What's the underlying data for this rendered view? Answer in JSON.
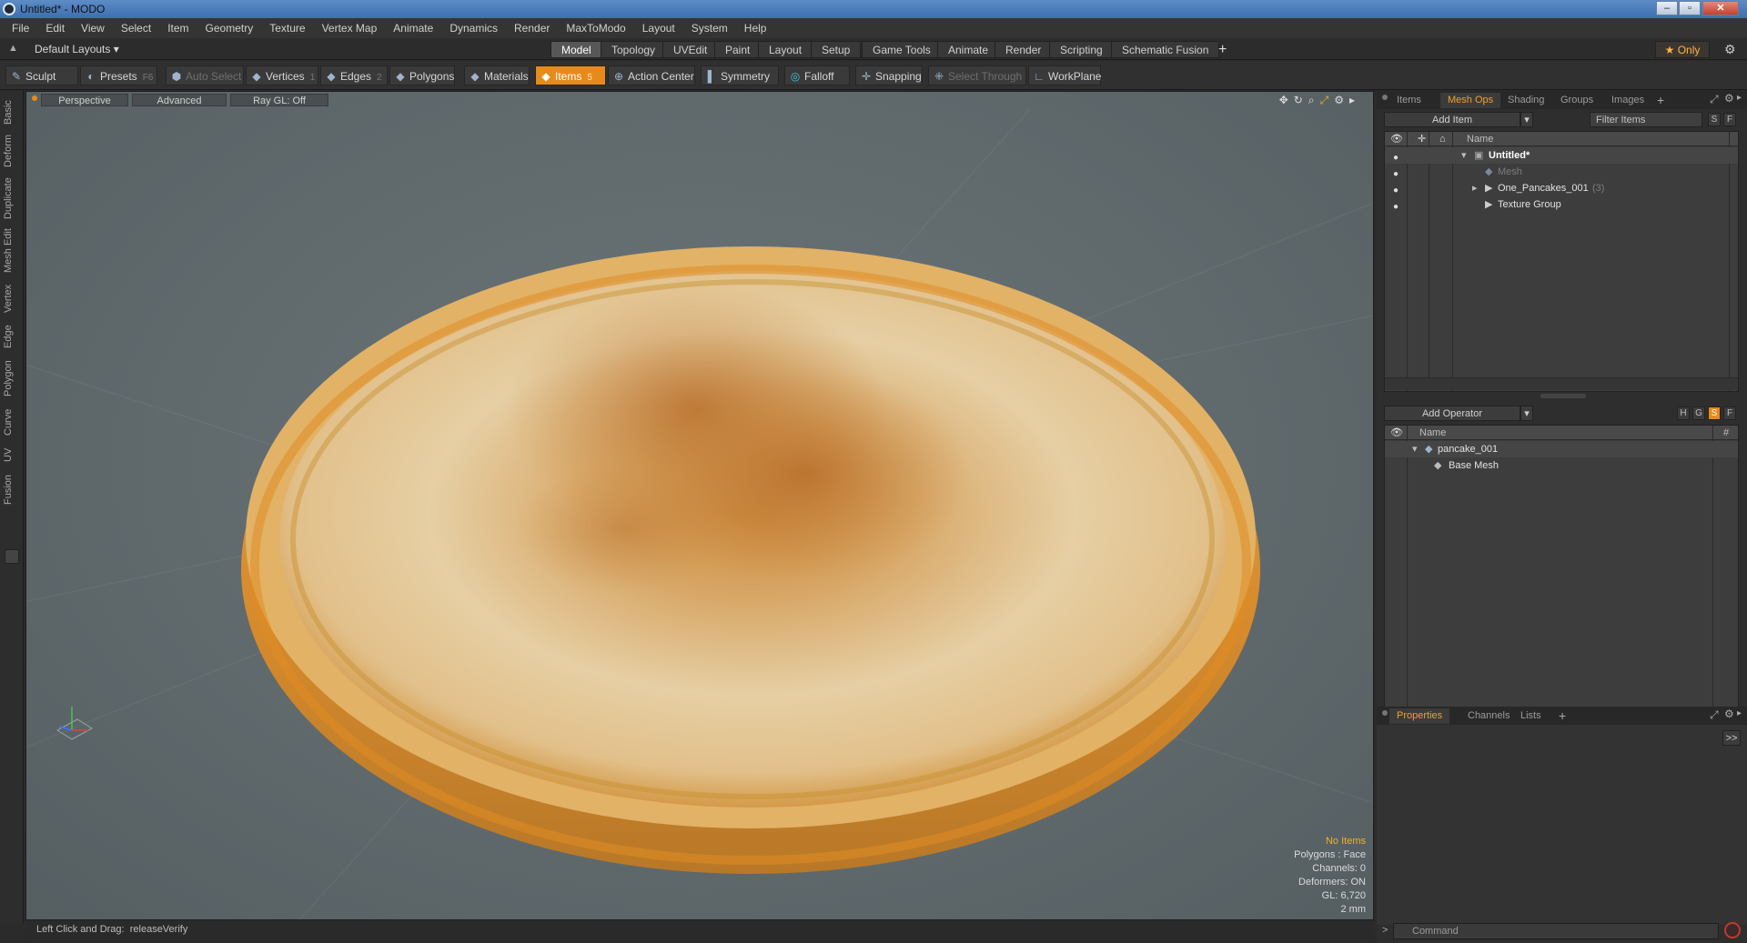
{
  "window": {
    "title": "Untitled* - MODO",
    "controls": [
      "minimize",
      "maximize",
      "close"
    ]
  },
  "menubar": [
    "File",
    "Edit",
    "View",
    "Select",
    "Item",
    "Geometry",
    "Texture",
    "Vertex Map",
    "Animate",
    "Dynamics",
    "Render",
    "MaxToModo",
    "Layout",
    "System",
    "Help"
  ],
  "layoutbar": {
    "layout_selector": "Default Layouts",
    "tabs": [
      "Model",
      "Topology",
      "UVEdit",
      "Paint",
      "Layout",
      "Setup",
      "Game Tools",
      "Animate",
      "Render",
      "Scripting",
      "Schematic Fusion"
    ],
    "active_tab": "Model",
    "add_tab": "+",
    "only_label": "Only"
  },
  "toolbar": {
    "sculpt": "Sculpt",
    "presets": "Presets",
    "presets_key": "F6",
    "auto_select": "Auto Select",
    "vertices": "Vertices",
    "vertices_count": "1",
    "edges": "Edges",
    "edges_count": "2",
    "polygons": "Polygons",
    "materials": "Materials",
    "items": "Items",
    "items_count": "5",
    "action_center": "Action Center",
    "symmetry": "Symmetry",
    "falloff": "Falloff",
    "snapping": "Snapping",
    "select_through": "Select Through",
    "workplane": "WorkPlane"
  },
  "left_tabs": [
    "Basic",
    "Deform",
    "Duplicate",
    "Mesh Edit",
    "Vertex",
    "Edge",
    "Polygon",
    "Curve",
    "UV",
    "Fusion"
  ],
  "viewport": {
    "view_mode": "Perspective",
    "shading": "Advanced",
    "raygl": "Ray GL: Off",
    "info": {
      "no_items": "No Items",
      "polygons": "Polygons : Face",
      "channels": "Channels: 0",
      "deformers": "Deformers: ON",
      "gl": "GL: 6,720",
      "scale": "2 mm"
    }
  },
  "status": {
    "hint": "Left Click and Drag:",
    "action": "releaseVerify"
  },
  "items_panel": {
    "tabs": [
      "Items",
      "Mesh Ops",
      "Shading",
      "Groups",
      "Images",
      "+"
    ],
    "active_tab": "Mesh Ops",
    "add_item": "Add Item",
    "filter_placeholder": "Filter Items",
    "btn_s": "S",
    "btn_f": "F",
    "column_name": "Name",
    "rows": [
      {
        "label": "Untitled*",
        "count": ""
      },
      {
        "label": "Mesh",
        "count": ""
      },
      {
        "label": "One_Pancakes_001",
        "count": "(3)"
      },
      {
        "label": "Texture Group",
        "count": ""
      }
    ]
  },
  "meshops_panel": {
    "add_operator": "Add Operator",
    "btn_h": "H",
    "btn_g": "G",
    "btn_s": "S",
    "btn_f": "F",
    "column_name": "Name",
    "column_hash": "#",
    "rows": [
      {
        "label": "pancake_001"
      },
      {
        "label": "Base Mesh"
      }
    ]
  },
  "properties_panel": {
    "tabs": [
      "Properties",
      "Channels",
      "Lists",
      "+"
    ],
    "active_tab": "Properties",
    "expand": ">>",
    "command_placeholder": "Command"
  },
  "colors": {
    "accent": "#e88a1a",
    "viewport_bg": "#5f696c",
    "active_tab_text": "#f0a030"
  }
}
